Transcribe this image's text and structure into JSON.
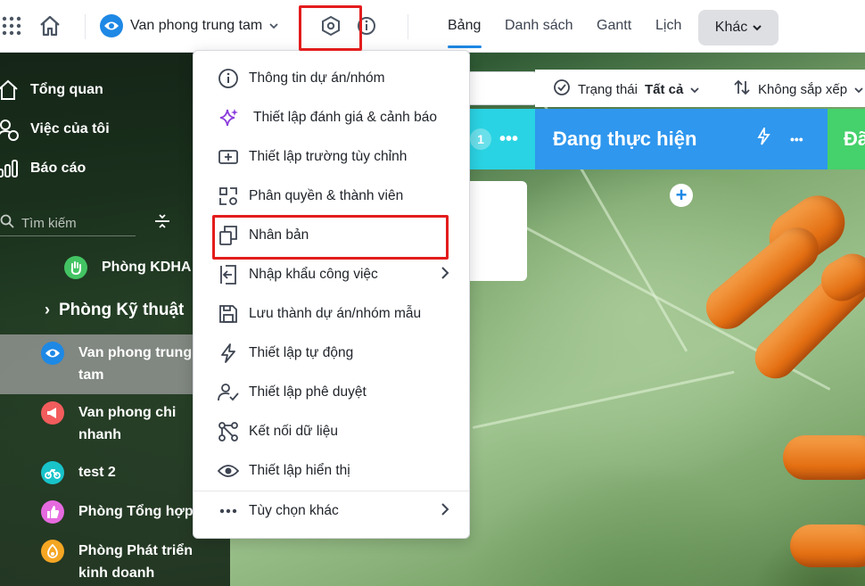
{
  "topbar": {
    "project_name": "Van phong trung tam",
    "tabs": [
      "Bảng",
      "Danh sách",
      "Gantt",
      "Lịch"
    ],
    "more_label": "Khác"
  },
  "sidebar": {
    "nav": [
      "Tổng quan",
      "Việc của tôi",
      "Báo cáo"
    ],
    "search_placeholder": "Tìm kiếm",
    "items": [
      {
        "label": "Phòng KDHA",
        "color": "#43c463"
      },
      {
        "label": "Phòng Kỹ thuật"
      },
      {
        "label_1": "Van phong trung",
        "label_2": "tam",
        "color": "#1e88e5"
      },
      {
        "label_1": "Van phong chi",
        "label_2": "nhanh",
        "color": "#f25c5c"
      },
      {
        "label": "test 2",
        "color": "#18c3c9"
      },
      {
        "label": "Phòng Tổng hợp",
        "color": "#e66adf"
      },
      {
        "label_1": "Phòng Phát triển",
        "label_2": "kinh doanh",
        "color": "#f5a623"
      }
    ]
  },
  "board": {
    "status_label": "Trạng thái",
    "status_value": "Tất cả",
    "sort_label": "Không sắp xếp",
    "col1_count": "1",
    "col2_title": "Đang thực hiện",
    "col3_title": "Đã"
  },
  "menu": {
    "items": [
      "Thông tin dự án/nhóm",
      "Thiết lập đánh giá & cảnh báo",
      "Thiết lập trường tùy chỉnh",
      "Phân quyền & thành viên",
      "Nhân bản",
      "Nhập khẩu công việc",
      "Lưu thành dự án/nhóm mẫu",
      "Thiết lập tự động",
      "Thiết lập phê duyệt",
      "Kết nối dữ liệu",
      "Thiết lập hiển thị",
      "Tùy chọn khác"
    ]
  },
  "colors": {
    "accent": "#1e88e5",
    "highlight": "#e31c1c",
    "column_cyan": "#2ad3e3",
    "column_blue": "#2f97ee",
    "column_green": "#45d16b"
  }
}
